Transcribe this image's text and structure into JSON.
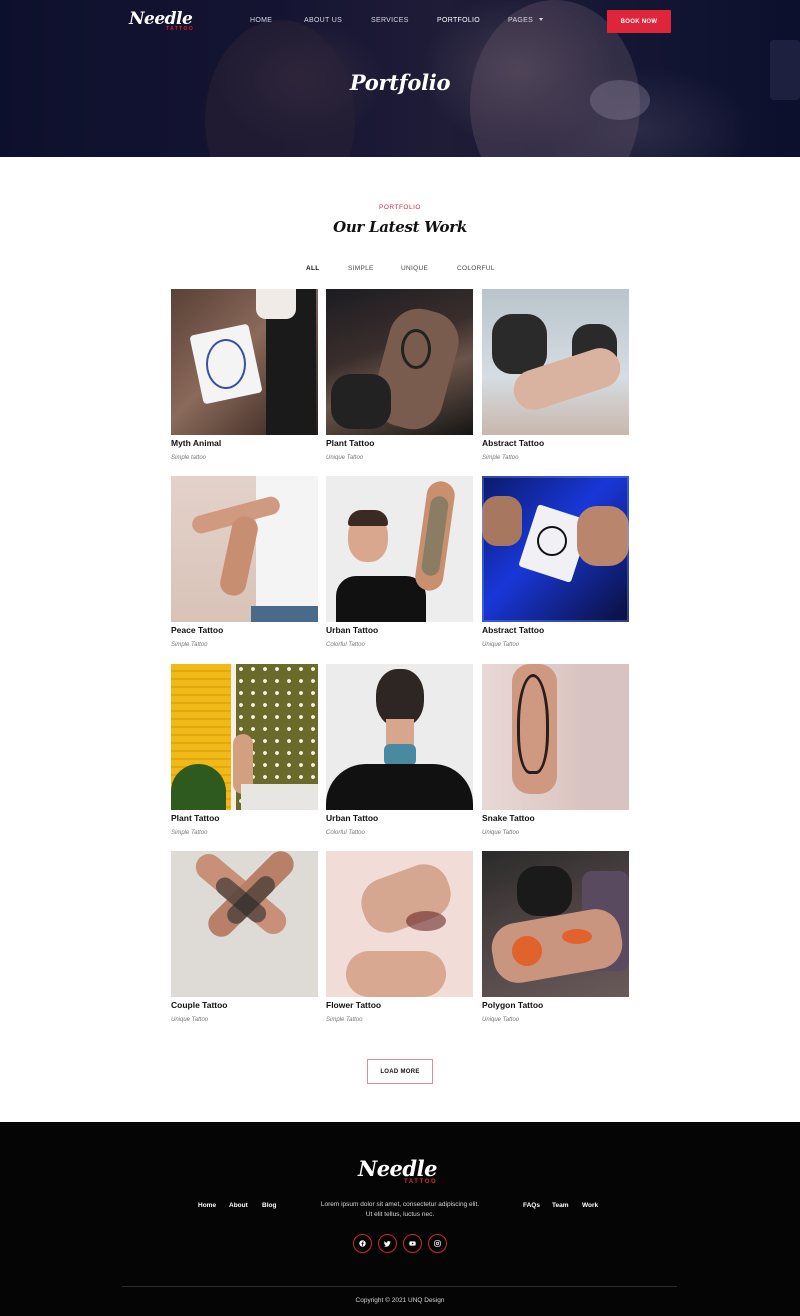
{
  "brand": {
    "name": "Needle",
    "tagline": "TATTOO"
  },
  "nav": {
    "items": [
      {
        "label": "HOME"
      },
      {
        "label": "ABOUT US"
      },
      {
        "label": "SERVICES"
      },
      {
        "label": "PORTFOLIO"
      },
      {
        "label": "PAGES"
      }
    ],
    "active": "PORTFOLIO",
    "cta": "BOOK NOW"
  },
  "hero": {
    "title": "Portfolio"
  },
  "section": {
    "eyebrow": "PORTFOLIO",
    "title": "Our Latest Work"
  },
  "filters": [
    {
      "label": "ALL",
      "active": true
    },
    {
      "label": "SIMPLE",
      "active": false
    },
    {
      "label": "UNIQUE",
      "active": false
    },
    {
      "label": "COLORFUL",
      "active": false
    }
  ],
  "portfolio": [
    {
      "title": "Myth Animal",
      "category": "Simple tattoo"
    },
    {
      "title": "Plant Tattoo",
      "category": "Unique Tattoo"
    },
    {
      "title": "Abstract Tattoo",
      "category": "Simple Tattoo"
    },
    {
      "title": "Peace Tattoo",
      "category": "Simple Tattoo"
    },
    {
      "title": "Urban Tattoo",
      "category": "Colorful Tattoo"
    },
    {
      "title": "Abstract Tattoo",
      "category": "Unique Tattoo"
    },
    {
      "title": "Plant Tattoo",
      "category": "Simple Tattoo"
    },
    {
      "title": "Urban Tattoo",
      "category": "Colorful Tattoo"
    },
    {
      "title": "Snake Tattoo",
      "category": "Unique Tattoo"
    },
    {
      "title": "Couple Tattoo",
      "category": "Unique Tattoo"
    },
    {
      "title": "Flower Tattoo",
      "category": "Simple Tattoo"
    },
    {
      "title": "Polygon Tattoo",
      "category": "Unique Tattoo"
    }
  ],
  "load_more": "LOAD MORE",
  "footer": {
    "logo": "Needle",
    "logo_sub": "TATTOO",
    "links_left": [
      "Home",
      "About",
      "Blog"
    ],
    "links_right": [
      "FAQs",
      "Team",
      "Work"
    ],
    "text_line1": "Lorem ipsum dolor sit amet, consectetur adipiscing elit.",
    "text_line2": "Ut elit tellus, luctus nec.",
    "social": [
      "facebook-icon",
      "twitter-icon",
      "youtube-icon",
      "instagram-icon"
    ],
    "copyright": "Copyright © 2021 UNQ Design"
  },
  "colors": {
    "accent": "#e0243a",
    "footer_bg": "#050505",
    "hero_bg": "#151735"
  }
}
